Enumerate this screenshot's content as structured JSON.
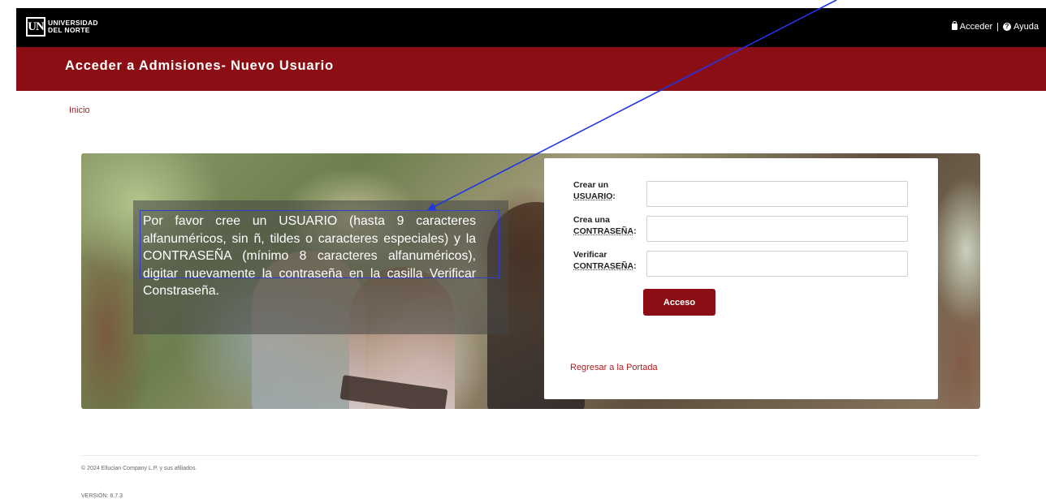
{
  "header": {
    "logo_mark": "UN",
    "logo_line1": "UNIVERSIDAD",
    "logo_line2": "DEL NORTE",
    "login_link": "Acceder",
    "separator": "|",
    "help_link": "Ayuda",
    "help_icon_glyph": "?",
    "title": "Acceder a Admisiones- Nuevo Usuario",
    "colors": {
      "topbar": "#000000",
      "brand_red": "#8b0e15"
    }
  },
  "breadcrumb": {
    "home": "Inicio"
  },
  "hero": {
    "instructions": "Por favor cree un USUARIO (hasta 9 caracteres alfanuméricos, sin ñ, tildes o caracteres especiales) y la CONTRASEÑA (mínimo 8 caracteres alfanuméricos), digitar nuevamente la contraseña en la casilla Verificar Constraseña."
  },
  "form": {
    "user": {
      "label_line1": "Crear un",
      "label_line2": "USUARIO",
      "label_colon": ":",
      "value": ""
    },
    "password": {
      "label_line1": "Crea una",
      "label_line2": "CONTRASEÑA",
      "label_colon": ":",
      "value": ""
    },
    "verify": {
      "label_line1": "Verificar",
      "label_line2": "CONTRASEÑA",
      "label_colon": ":",
      "value": ""
    },
    "submit_label": "Acceso",
    "back_link": "Regresar a la Portada"
  },
  "footer": {
    "copyright": "© 2024 Ellucian Company L.P. y sus afiliados.",
    "version": "VERSIÓN: 8.7.3"
  },
  "annotation": {
    "color": "#1f35e0"
  }
}
